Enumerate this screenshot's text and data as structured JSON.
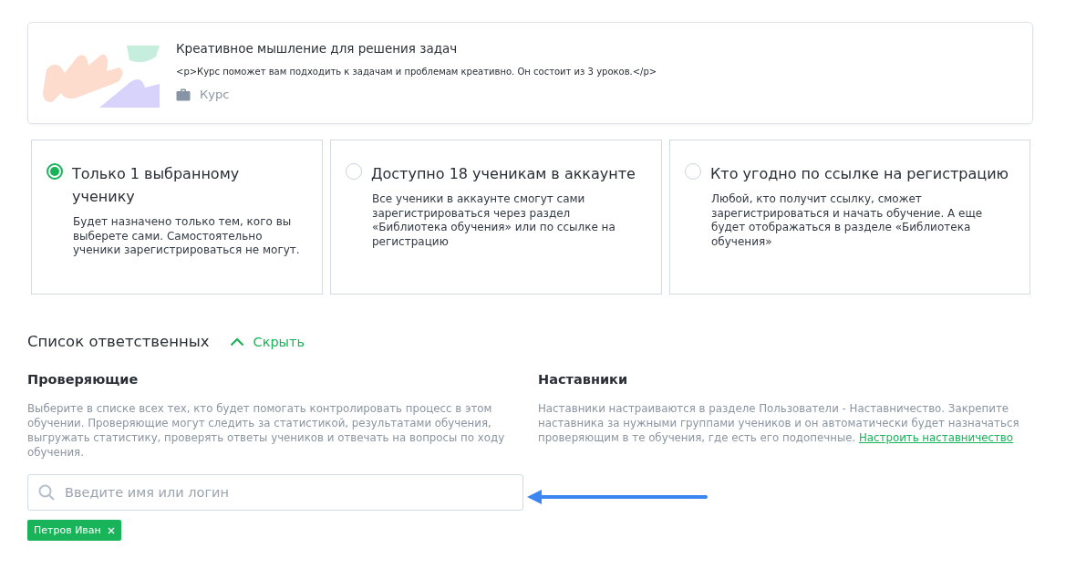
{
  "course": {
    "title": "Креативное мышление для решения задач",
    "description": "<p>Курс поможет вам подходить к задачам и проблемам креативно. Он состоит из 3 уроков.</p>",
    "type": "Курс"
  },
  "access_options": [
    {
      "title": "Только 1 выбранному ученику",
      "description": "Будет назначено только тем, кого вы выберете сами. Самостоятельно ученики зарегистрироваться не могут.",
      "selected": true
    },
    {
      "title": "Доступно 18 ученикам в аккаунте",
      "description": "Все ученики в аккаунте смогут сами зарегистрироваться через раздел «Библиотека обучения» или по ссылке на регистрацию",
      "selected": false
    },
    {
      "title": "Кто угодно по ссылке на регистрацию",
      "description": "Любой, кто получит ссылку, сможет зарегистрироваться и начать обучение. А еще будет отображаться в разделе «Библиотека обучения»",
      "selected": false
    }
  ],
  "responsible": {
    "title": "Список ответственных",
    "toggle": "Скрыть",
    "expanded": true
  },
  "reviewers": {
    "title": "Проверяющие",
    "description": "Выберите в списке всех тех, кто будет помогать контролировать процесс в этом обучении. Проверяющие могут следить за статистикой, результатами обучения, выгружать статистику, проверять ответы учеников и отвечать на вопросы по ходу обучения.",
    "search": {
      "placeholder": "Введите имя или логин"
    },
    "tags": [
      "Петров Иван"
    ]
  },
  "mentors": {
    "title": "Наставники",
    "description": "Наставники настраиваются в разделе Пользователи - Наставничество. Закрепите наставника за нужными группами учеников и он автоматически будет назначаться проверяющим в те обучения, где есть его подопечные.",
    "link": "Настроить наставничество"
  }
}
